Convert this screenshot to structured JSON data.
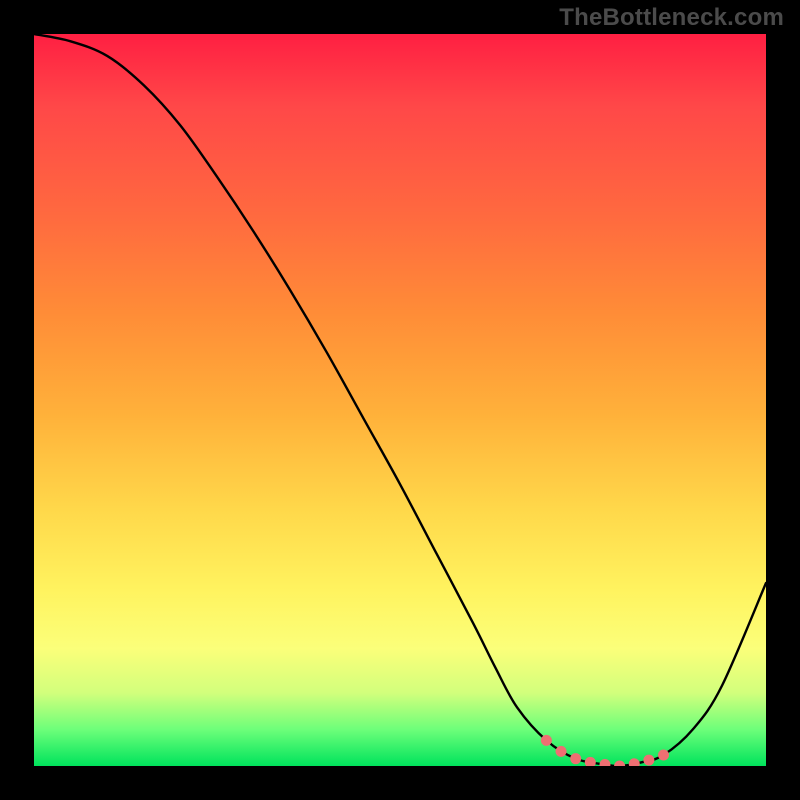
{
  "watermark": "TheBottleneck.com",
  "chart_data": {
    "type": "line",
    "title": "",
    "xlabel": "",
    "ylabel": "",
    "xlim": [
      0,
      100
    ],
    "ylim": [
      0,
      100
    ],
    "series": [
      {
        "name": "bottleneck-curve",
        "x": [
          0,
          5,
          10,
          15,
          20,
          25,
          30,
          35,
          40,
          45,
          50,
          55,
          60,
          63,
          66,
          70,
          74,
          78,
          80,
          83,
          86,
          90,
          94,
          100
        ],
        "values": [
          100,
          99,
          97,
          93,
          87.5,
          80.5,
          73,
          65,
          56.5,
          47.5,
          38.5,
          29,
          19.5,
          13.5,
          8,
          3.5,
          1,
          0.2,
          0,
          0.5,
          1.5,
          5,
          11,
          25
        ]
      }
    ],
    "markers": {
      "name": "highlight-dots",
      "color": "#ee6f72",
      "x": [
        70,
        72,
        74,
        76,
        78,
        80,
        82,
        84,
        86
      ],
      "values": [
        3.5,
        2.0,
        1.0,
        0.5,
        0.2,
        0.0,
        0.3,
        0.8,
        1.5
      ]
    },
    "gradient_stops": [
      {
        "pos": 0,
        "color": "#ff1f42"
      },
      {
        "pos": 25,
        "color": "#ff6a3f"
      },
      {
        "pos": 52,
        "color": "#ffb13a"
      },
      {
        "pos": 76,
        "color": "#fff35f"
      },
      {
        "pos": 95,
        "color": "#6dff7a"
      },
      {
        "pos": 100,
        "color": "#00e35c"
      }
    ]
  }
}
